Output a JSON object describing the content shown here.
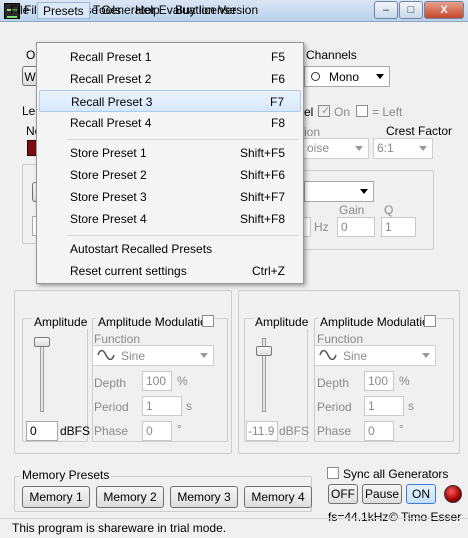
{
  "window": {
    "title": "Filtered Noise Generator Evaluation Version"
  },
  "window_buttons": {
    "minimize": "–",
    "maximize": "□",
    "close": "X"
  },
  "menubar": {
    "items": [
      "File",
      "Presets",
      "Tools",
      "Help",
      "Buy license"
    ]
  },
  "presets_menu": {
    "recall": [
      {
        "label": "Recall Preset 1",
        "shortcut": "F5"
      },
      {
        "label": "Recall Preset 2",
        "shortcut": "F6"
      },
      {
        "label": "Recall Preset 3",
        "shortcut": "F7"
      },
      {
        "label": "Recall Preset 4",
        "shortcut": "F8"
      }
    ],
    "store": [
      {
        "label": "Store Preset 1",
        "shortcut": "Shift+F5"
      },
      {
        "label": "Store Preset 2",
        "shortcut": "Shift+F6"
      },
      {
        "label": "Store Preset 3",
        "shortcut": "Shift+F7"
      },
      {
        "label": "Store Preset 4",
        "shortcut": "Shift+F8"
      }
    ],
    "autostart": {
      "label": "Autostart Recalled Presets"
    },
    "reset": {
      "label": "Reset current settings",
      "shortcut": "Ctrl+Z"
    }
  },
  "behind": {
    "left_partial_1": "O",
    "left_partial_2": "W",
    "left_partial_3": "Le",
    "left_partial_4": "No",
    "channels_label": "Channels",
    "channels_value": "Mono",
    "el_partial": "el",
    "on_label": "On",
    "left_check_label": "= Left",
    "crest_factor_label": "Crest Factor",
    "ion_partial": "ion",
    "noise_partial": "oise",
    "crest_value": "6:1",
    "gain_label": "Gain",
    "q_label": "Q",
    "hz_label": "Hz",
    "gain_value": "0",
    "q_value": "1"
  },
  "generators": [
    {
      "amplitude_label": "Amplitude",
      "amplitude_value": "0",
      "unit": "dBFS",
      "am_label": "Amplitude Modulation",
      "function_label": "Function",
      "function_value": "Sine",
      "depth_label": "Depth",
      "depth_value": "100",
      "depth_unit": "%",
      "period_label": "Period",
      "period_value": "1",
      "period_unit": "s",
      "phase_label": "Phase",
      "phase_value": "0",
      "phase_unit": "°"
    },
    {
      "amplitude_label": "Amplitude",
      "amplitude_value": "-11.9",
      "unit": "dBFS",
      "am_label": "Amplitude Modulation",
      "function_label": "Function",
      "function_value": "Sine",
      "depth_label": "Depth",
      "depth_value": "100",
      "depth_unit": "%",
      "period_label": "Period",
      "period_value": "1",
      "period_unit": "s",
      "phase_label": "Phase",
      "phase_value": "0",
      "phase_unit": "°"
    }
  ],
  "memory_presets": {
    "title": "Memory Presets",
    "buttons": [
      "Memory 1",
      "Memory 2",
      "Memory 3",
      "Memory 4"
    ]
  },
  "controls": {
    "sync_label": "Sync all Generators",
    "off": "OFF",
    "pause": "Pause",
    "on": "ON",
    "sample_rate": "fs=44.1kHz",
    "copyright": "© Timo Esser"
  },
  "status": {
    "text": "This program is shareware in trial mode."
  }
}
